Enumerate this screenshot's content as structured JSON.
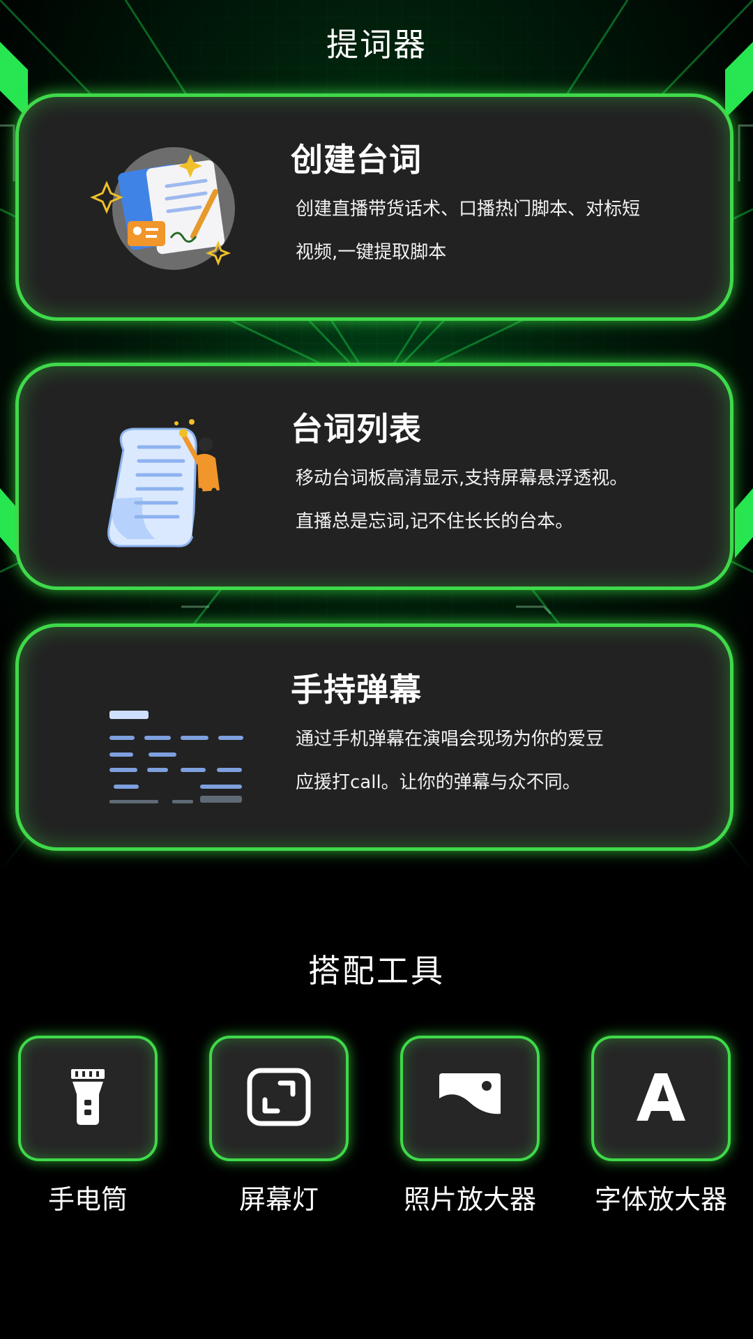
{
  "header": {
    "title": "提词器"
  },
  "cards": [
    {
      "title": "创建台词",
      "line1": "创建直播带货话术、口播热门脚本、对标短",
      "line2": "视频,一键提取脚本",
      "icon": "script-document-icon"
    },
    {
      "title": "台词列表",
      "line1": "移动台词板高清显示,支持屏幕悬浮透视。",
      "line2": "直播总是忘词,记不住长长的台本。",
      "icon": "scroll-person-icon"
    },
    {
      "title": "手持弹幕",
      "line1": "通过手机弹幕在演唱会现场为你的爱豆",
      "line2": "应援打call。让你的弹幕与众不同。",
      "icon": "danmaku-icon"
    }
  ],
  "tools_section": {
    "title": "搭配工具"
  },
  "tools": [
    {
      "label": "手电筒",
      "icon": "flashlight-icon"
    },
    {
      "label": "屏幕灯",
      "icon": "screen-light-icon"
    },
    {
      "label": "照片放大器",
      "icon": "photo-icon"
    },
    {
      "label": "字体放大器",
      "icon": "font-icon"
    }
  ],
  "colors": {
    "accent": "#3fd94a",
    "card_bg": "#222222",
    "page_bg": "#000000"
  }
}
